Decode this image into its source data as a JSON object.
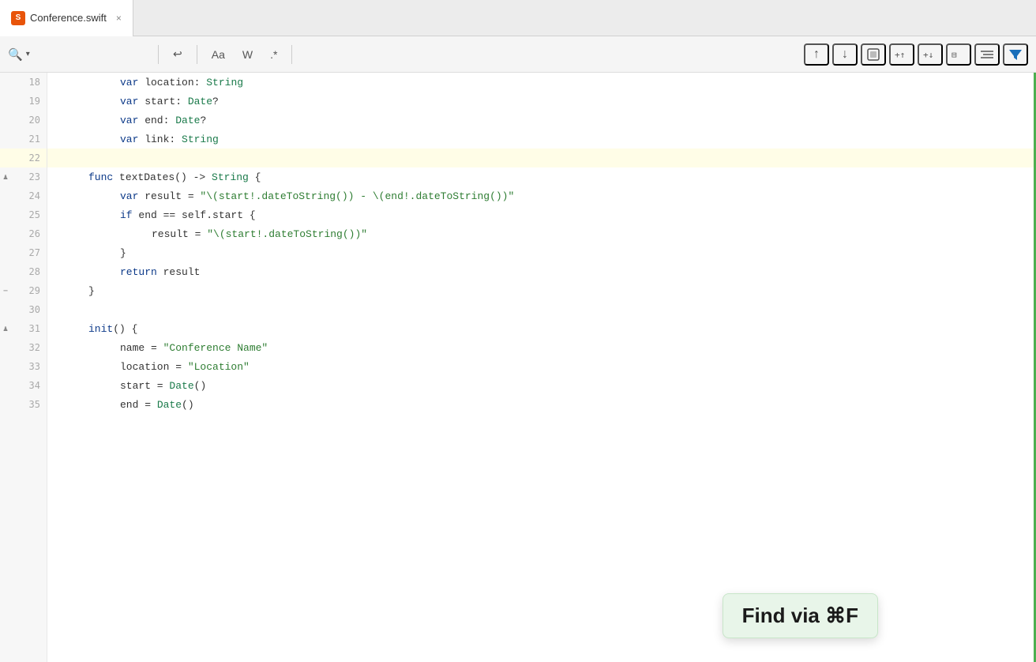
{
  "tab": {
    "icon_label": "S",
    "filename": "Conference.swift",
    "close_label": "×"
  },
  "toolbar": {
    "search_icon": "🔍",
    "search_chevron": "▾",
    "undo_label": "↩",
    "match_case_label": "Aa",
    "whole_word_label": "W",
    "regex_label": ".*",
    "arrow_up_label": "↑",
    "arrow_down_label": "↓",
    "select_match_label": "▣",
    "add_cursor_up_label": "⊕↑",
    "add_cursor_down_label": "⊕↓",
    "select_col_label": "⊟",
    "indent_label": "≡",
    "filter_label": "▼"
  },
  "lines": [
    {
      "num": "18",
      "indent": 2,
      "tokens": [
        {
          "t": "kw",
          "v": "var"
        },
        {
          "t": "plain",
          "v": " location: "
        },
        {
          "t": "type",
          "v": "String"
        }
      ],
      "gutter": null
    },
    {
      "num": "19",
      "indent": 2,
      "tokens": [
        {
          "t": "kw",
          "v": "var"
        },
        {
          "t": "plain",
          "v": " start: "
        },
        {
          "t": "type",
          "v": "Date"
        },
        {
          "t": "plain",
          "v": "?"
        }
      ],
      "gutter": null
    },
    {
      "num": "20",
      "indent": 2,
      "tokens": [
        {
          "t": "kw",
          "v": "var"
        },
        {
          "t": "plain",
          "v": " end: "
        },
        {
          "t": "type",
          "v": "Date"
        },
        {
          "t": "plain",
          "v": "?"
        }
      ],
      "gutter": null
    },
    {
      "num": "21",
      "indent": 2,
      "tokens": [
        {
          "t": "kw",
          "v": "var"
        },
        {
          "t": "plain",
          "v": " link: "
        },
        {
          "t": "type",
          "v": "String"
        }
      ],
      "gutter": null
    },
    {
      "num": "22",
      "indent": 0,
      "tokens": [],
      "gutter": null,
      "highlighted": true
    },
    {
      "num": "23",
      "indent": 1,
      "tokens": [
        {
          "t": "kw",
          "v": "func"
        },
        {
          "t": "plain",
          "v": " textDates() -> "
        },
        {
          "t": "type",
          "v": "String"
        },
        {
          "t": "plain",
          "v": " {"
        }
      ],
      "gutter": "shield"
    },
    {
      "num": "24",
      "indent": 2,
      "tokens": [
        {
          "t": "kw",
          "v": "var"
        },
        {
          "t": "plain",
          "v": " result = "
        },
        {
          "t": "str",
          "v": "\"\\(start!.dateToString()) - \\(end!.dateToString())\""
        }
      ],
      "gutter": null
    },
    {
      "num": "25",
      "indent": 2,
      "tokens": [
        {
          "t": "kw",
          "v": "if"
        },
        {
          "t": "plain",
          "v": " end == self.start {"
        }
      ],
      "gutter": null
    },
    {
      "num": "26",
      "indent": 3,
      "tokens": [
        {
          "t": "plain",
          "v": "result = "
        },
        {
          "t": "str",
          "v": "\"\\(start!.dateToString())\""
        }
      ],
      "gutter": null
    },
    {
      "num": "27",
      "indent": 2,
      "tokens": [
        {
          "t": "plain",
          "v": "}"
        }
      ],
      "gutter": null
    },
    {
      "num": "28",
      "indent": 2,
      "tokens": [
        {
          "t": "kw",
          "v": "return"
        },
        {
          "t": "plain",
          "v": " result"
        }
      ],
      "gutter": null
    },
    {
      "num": "29",
      "indent": 1,
      "tokens": [
        {
          "t": "plain",
          "v": "}"
        }
      ],
      "gutter": "minus"
    },
    {
      "num": "30",
      "indent": 0,
      "tokens": [],
      "gutter": null
    },
    {
      "num": "31",
      "indent": 1,
      "tokens": [
        {
          "t": "kw",
          "v": "init"
        },
        {
          "t": "plain",
          "v": "() {"
        }
      ],
      "gutter": "shield"
    },
    {
      "num": "32",
      "indent": 2,
      "tokens": [
        {
          "t": "plain",
          "v": "name = "
        },
        {
          "t": "str",
          "v": "\"Conference Name\""
        }
      ],
      "gutter": null
    },
    {
      "num": "33",
      "indent": 2,
      "tokens": [
        {
          "t": "plain",
          "v": "location = "
        },
        {
          "t": "str",
          "v": "\"Location\""
        }
      ],
      "gutter": null
    },
    {
      "num": "34",
      "indent": 2,
      "tokens": [
        {
          "t": "plain",
          "v": "start = "
        },
        {
          "t": "type",
          "v": "Date"
        },
        {
          "t": "plain",
          "v": "()"
        }
      ],
      "gutter": null
    },
    {
      "num": "35",
      "indent": 2,
      "tokens": [
        {
          "t": "plain",
          "v": "end = "
        },
        {
          "t": "type",
          "v": "Date"
        },
        {
          "t": "plain",
          "v": "()"
        }
      ],
      "gutter": null
    }
  ],
  "find_tooltip": {
    "label": "Find via ⌘F"
  }
}
